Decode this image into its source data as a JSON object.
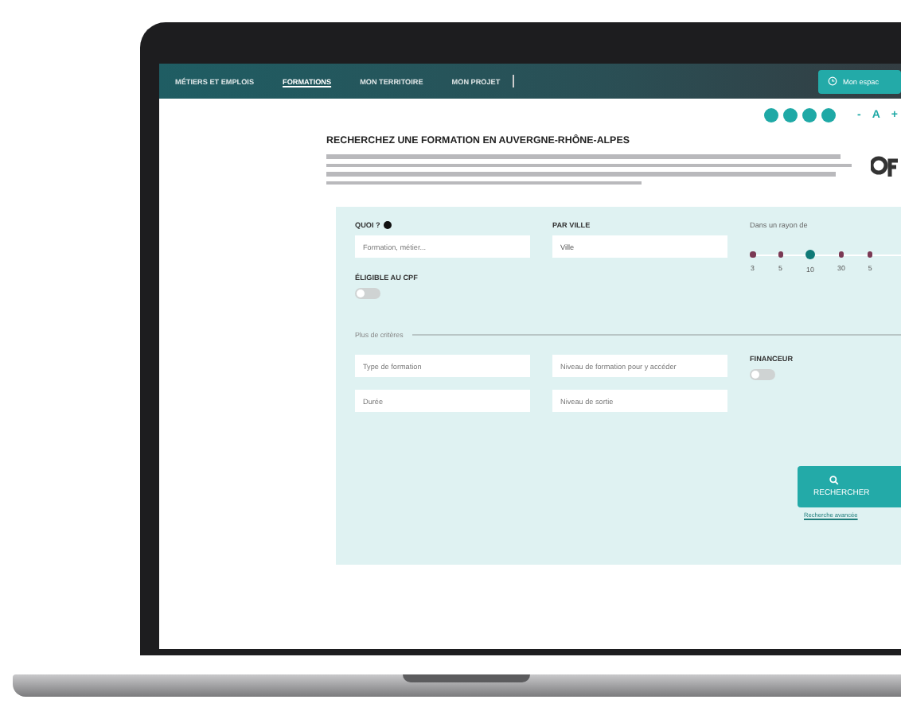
{
  "nav": {
    "items": [
      {
        "label": "MÉTIERS ET EMPLOIS",
        "selected": false
      },
      {
        "label": "FORMATIONS",
        "selected": true
      },
      {
        "label": "MON TERRITOIRE",
        "selected": false
      },
      {
        "label": "MON PROJET",
        "selected": false
      }
    ],
    "account_button": "Mon espac"
  },
  "font_controls": [
    "-",
    "A",
    "+"
  ],
  "title": "RECHERCHEZ UNE FORMATION EN AUVERGNE-RHÔNE-ALPES",
  "search": {
    "what": {
      "label": "QUOI ?",
      "placeholder": "Formation, métier..."
    },
    "city": {
      "label": "PAR VILLE",
      "value": "Ville"
    },
    "radius": {
      "label": "Dans un rayon de",
      "stops": [
        {
          "label": "3",
          "selected": false
        },
        {
          "label": "5",
          "selected": false
        },
        {
          "label": "10",
          "selected": true
        },
        {
          "label": "30",
          "selected": false
        },
        {
          "label": "5",
          "selected": false
        }
      ]
    },
    "cpf": {
      "label": "ÉLIGIBLE AU CPF",
      "on": false
    },
    "more_criteria": "Plus de critères",
    "filters": [
      {
        "placeholder": "Type de formation"
      },
      {
        "placeholder": "Niveau de formation pour y accéder"
      },
      {
        "placeholder": "Durée"
      },
      {
        "placeholder": "Niveau de sortie"
      }
    ],
    "funder": {
      "label": "FINANCEUR",
      "on": false
    },
    "submit": "RECHERCHER",
    "link": "Recherche avancée"
  }
}
